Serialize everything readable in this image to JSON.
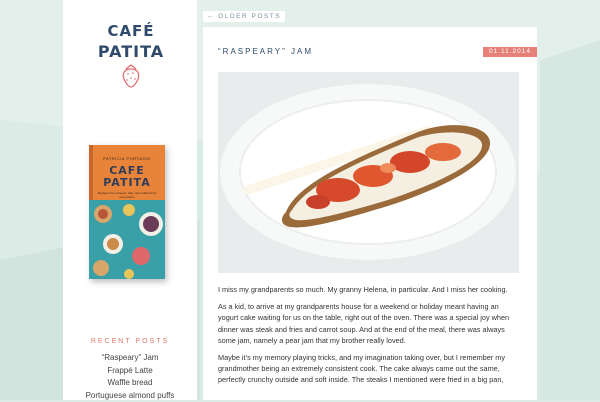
{
  "sidebar": {
    "logo": {
      "line1": "CAFÉ",
      "line2": "PATITA"
    },
    "book": {
      "author": "PATRICIA PORTASIO",
      "title_line1": "CAFE",
      "title_line2": "PATITA",
      "subtitle": "Recipes from Greece, Italy, and a little bit of everywhere"
    },
    "recent_posts_title": "RECENT POSTS",
    "recent_posts": [
      "“Raspeary” Jam",
      "Frappé Latte",
      "Waffle bread",
      "Portuguese almond puffs"
    ]
  },
  "nav": {
    "older_posts": "← OLDER POSTS"
  },
  "post": {
    "title": "“RASPEARY” JAM",
    "date": "01.11.2014",
    "paragraphs": [
      "I miss my grandparents so much. My granny Helena, in particular. And I miss her cooking.",
      "As a kid, to arrive at my grandparents house for a weekend or holiday meant having an yogurt cake waiting for us on the table, right out of the oven. There was a special joy when dinner was steak and fries and carrot soup. And at the end of the meal, there was always some jam, namely a pear jam that my brother really loved.",
      "Maybe it’s my memory playing tricks, and my imagination taking over, but I remember my grandmother being an extremely consistent cook. The cake always came out the same, perfectly crunchy outside and soft inside. The steaks I mentioned were fried in a big pan,"
    ]
  },
  "colors": {
    "accent": "#e8807a",
    "navy": "#2f4a6b",
    "background": "#dcebe6"
  }
}
